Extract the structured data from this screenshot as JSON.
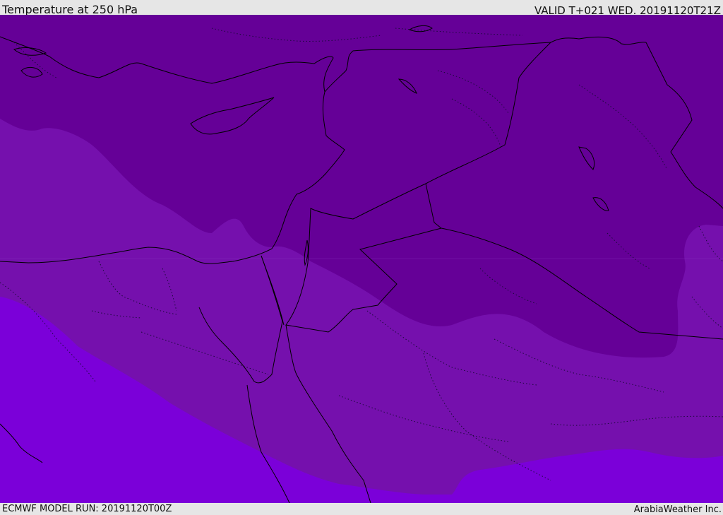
{
  "header": {
    "title": "Temperature at 250 hPa",
    "valid": "VALID T+021 WED. 20191120T21Z"
  },
  "footer": {
    "model_run": "ECMWF MODEL RUN: 20191120T00Z",
    "brand": "ArabiaWeather Inc."
  },
  "colors": {
    "background": "#e6e6e6",
    "band_coldest": "#650097",
    "band_cold": "#7510ad",
    "band_mid": "#7b00d9",
    "land_lines": "#000000"
  }
}
